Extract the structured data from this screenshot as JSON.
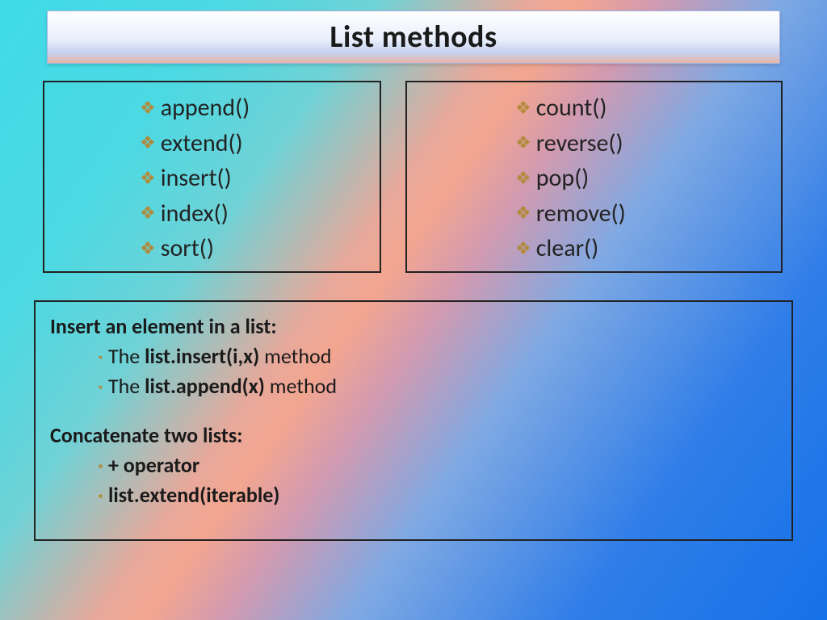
{
  "title": "List methods",
  "left_methods": [
    "append()",
    "extend()",
    "insert()",
    "index()",
    "sort()"
  ],
  "right_methods": [
    "count()",
    "reverse()",
    "pop()",
    "remove()",
    "clear()"
  ],
  "detail": {
    "insert_heading": "Insert an element in a list:",
    "insert_items": [
      {
        "pre": "The ",
        "bold": "list.insert(i,x)",
        "post": " method"
      },
      {
        "pre": "The ",
        "bold": "list.append(x)",
        "post": " method"
      }
    ],
    "concat_heading": "Concatenate two lists:",
    "concat_items": [
      "+ operator",
      "list.extend(iterable)"
    ]
  }
}
